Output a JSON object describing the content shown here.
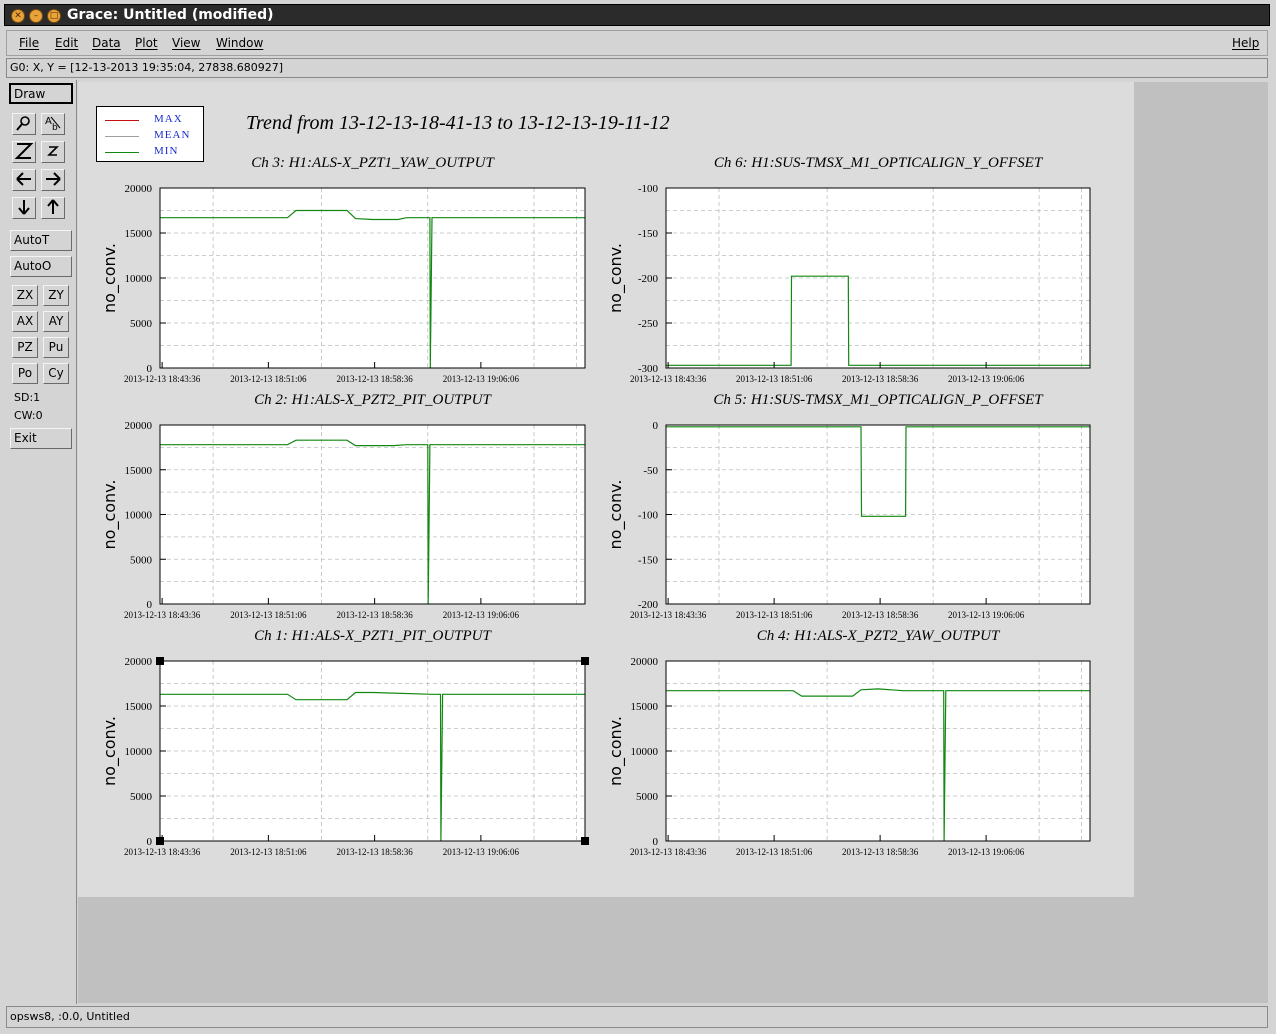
{
  "window": {
    "title": "Grace: Untitled (modified)"
  },
  "menubar": {
    "items": [
      "File",
      "Edit",
      "Data",
      "Plot",
      "View",
      "Window"
    ],
    "help": "Help"
  },
  "locator": "G0: X, Y = [12-13-2013 19:35:04, 27838.680927]",
  "toolbar": {
    "draw": "Draw",
    "autot": "AutoT",
    "autoo": "AutoO",
    "zx": "ZX",
    "zy": "ZY",
    "ax": "AX",
    "ay": "AY",
    "pz": "PZ",
    "pu": "Pu",
    "po": "Po",
    "cy": "Cy",
    "sd": "SD:1",
    "cw": "CW:0",
    "exit": "Exit",
    "icons": [
      "zoom-icon",
      "text-icon",
      "zoom-in-Z-icon",
      "zoom-out-z-icon",
      "arrow-left-icon",
      "arrow-right-icon",
      "arrow-down-icon",
      "arrow-up-icon"
    ]
  },
  "status": "opsws8, :0.0, Untitled",
  "graph": {
    "title": "Trend from 13-12-13-18-41-13 to 13-12-13-19-11-12",
    "legend": [
      {
        "label": "MAX",
        "color": "#c01010"
      },
      {
        "label": "MEAN",
        "color": "#a0a0a0"
      },
      {
        "label": "MIN",
        "color": "#118811"
      }
    ],
    "colors": {
      "max": "#c01010",
      "min": "#118811",
      "grid": "#bdbdbd",
      "label": "#1a2bd0"
    }
  },
  "chart_data": [
    {
      "type": "line",
      "title": "Ch 3: H1:ALS-X_PZT1_YAW_OUTPUT",
      "ylabel": "no_conv.",
      "ylim": [
        0,
        20000
      ],
      "yticks": [
        0,
        5000,
        10000,
        15000,
        20000
      ],
      "xticks": [
        "2013-12-13 18:43:36",
        "2013-12-13 18:51:06",
        "2013-12-13 18:58:36",
        "2013-12-13 19:06:06"
      ],
      "series": [
        {
          "name": "MIN",
          "x": [
            0,
            0.3,
            0.32,
            0.44,
            0.46,
            0.5,
            0.56,
            0.58,
            0.635,
            0.636,
            0.64,
            1.0
          ],
          "y": [
            16700,
            16700,
            17500,
            17500,
            16600,
            16500,
            16500,
            16700,
            16700,
            0,
            16700,
            16700
          ]
        }
      ]
    },
    {
      "type": "line",
      "title": "Ch 6: H1:SUS-TMSX_M1_OPTICALIGN_Y_OFFSET",
      "ylabel": "no_conv.",
      "ylim": [
        -300,
        -100
      ],
      "yticks": [
        -300,
        -250,
        -200,
        -150,
        -100
      ],
      "xticks": [
        "2013-12-13 18:43:36",
        "2013-12-13 18:51:06",
        "2013-12-13 18:58:36",
        "2013-12-13 19:06:06"
      ],
      "series": [
        {
          "name": "MIN",
          "x": [
            0,
            0.295,
            0.296,
            0.43,
            0.431,
            1.0
          ],
          "y": [
            -297,
            -297,
            -198,
            -198,
            -297,
            -297
          ]
        }
      ]
    },
    {
      "type": "line",
      "title": "Ch 2: H1:ALS-X_PZT2_PIT_OUTPUT",
      "ylabel": "no_conv.",
      "ylim": [
        0,
        20000
      ],
      "yticks": [
        0,
        5000,
        10000,
        15000,
        20000
      ],
      "xticks": [
        "2013-12-13 18:43:36",
        "2013-12-13 18:51:06",
        "2013-12-13 18:58:36",
        "2013-12-13 19:06:06"
      ],
      "series": [
        {
          "name": "MIN",
          "x": [
            0,
            0.3,
            0.32,
            0.44,
            0.46,
            0.55,
            0.58,
            0.63,
            0.631,
            0.635,
            1.0
          ],
          "y": [
            17800,
            17800,
            18300,
            18300,
            17700,
            17700,
            17800,
            17800,
            0,
            17800,
            17800
          ]
        }
      ]
    },
    {
      "type": "line",
      "title": "Ch 5: H1:SUS-TMSX_M1_OPTICALIGN_P_OFFSET",
      "ylabel": "no_conv.",
      "ylim": [
        -200,
        0
      ],
      "yticks": [
        -200,
        -150,
        -100,
        -50,
        0
      ],
      "xticks": [
        "2013-12-13 18:43:36",
        "2013-12-13 18:51:06",
        "2013-12-13 18:58:36",
        "2013-12-13 19:06:06"
      ],
      "series": [
        {
          "name": "MIN",
          "x": [
            0,
            0.46,
            0.461,
            0.565,
            0.566,
            1.0
          ],
          "y": [
            -2,
            -2,
            -102,
            -102,
            -2,
            -2
          ]
        }
      ]
    },
    {
      "type": "line",
      "title": "Ch 1: H1:ALS-X_PZT1_PIT_OUTPUT",
      "ylabel": "no_conv.",
      "ylim": [
        0,
        20000
      ],
      "yticks": [
        0,
        5000,
        10000,
        15000,
        20000
      ],
      "xticks": [
        "2013-12-13 18:43:36",
        "2013-12-13 18:51:06",
        "2013-12-13 18:58:36",
        "2013-12-13 19:06:06"
      ],
      "series": [
        {
          "name": "MIN",
          "x": [
            0,
            0.3,
            0.32,
            0.44,
            0.46,
            0.5,
            0.64,
            0.66,
            0.661,
            0.665,
            1.0
          ],
          "y": [
            16300,
            16300,
            15700,
            15700,
            16500,
            16500,
            16300,
            16300,
            0,
            16300,
            16300
          ]
        }
      ]
    },
    {
      "type": "line",
      "title": "Ch 4: H1:ALS-X_PZT2_YAW_OUTPUT",
      "ylabel": "no_conv.",
      "ylim": [
        0,
        20000
      ],
      "yticks": [
        0,
        5000,
        10000,
        15000,
        20000
      ],
      "xticks": [
        "2013-12-13 18:43:36",
        "2013-12-13 18:51:06",
        "2013-12-13 18:58:36",
        "2013-12-13 19:06:06"
      ],
      "series": [
        {
          "name": "MIN",
          "x": [
            0,
            0.3,
            0.32,
            0.44,
            0.46,
            0.5,
            0.56,
            0.58,
            0.655,
            0.656,
            0.66,
            1.0
          ],
          "y": [
            16700,
            16700,
            16100,
            16100,
            16800,
            16900,
            16700,
            16700,
            16700,
            0,
            16700,
            16700
          ]
        }
      ]
    }
  ]
}
